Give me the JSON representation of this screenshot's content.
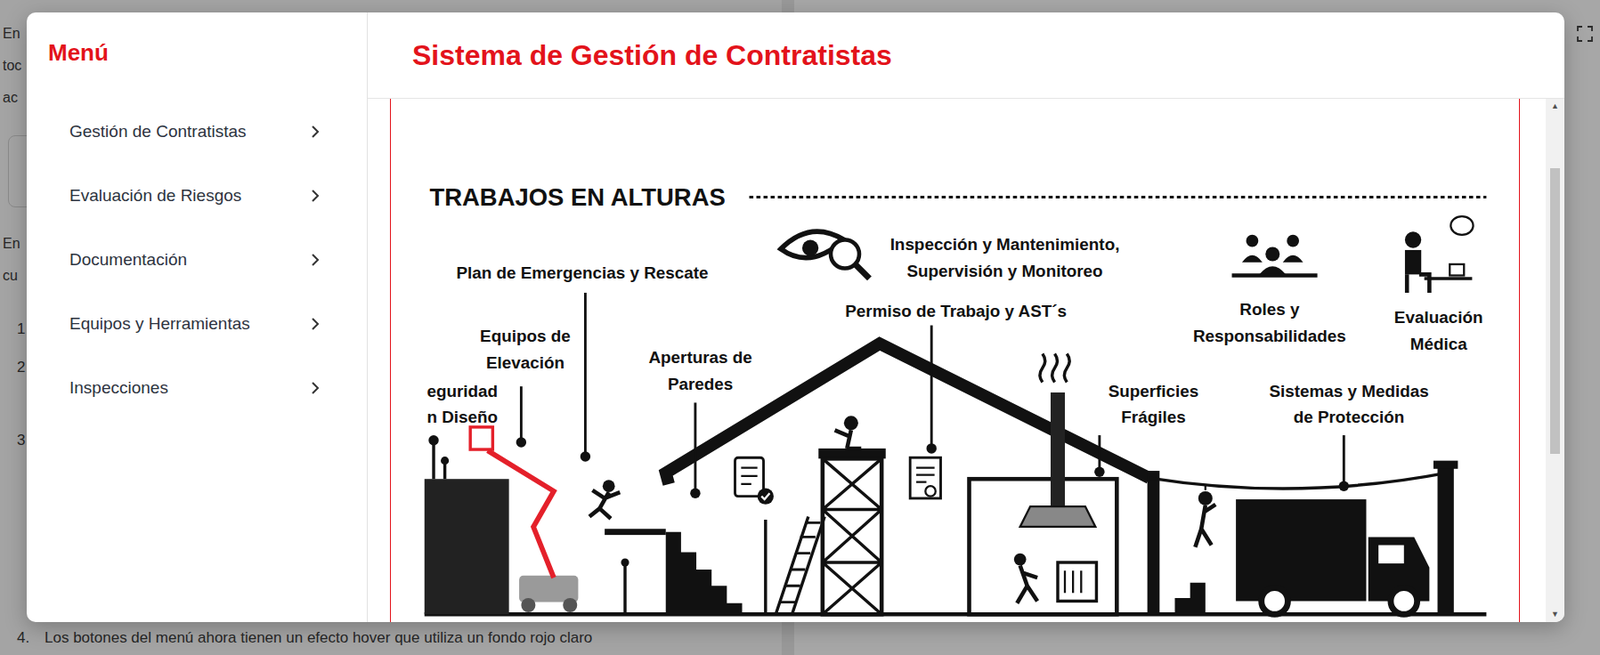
{
  "page": {
    "paragraphs": [
      [
        "En",
        "toc",
        "ac"
      ],
      [
        "En",
        "cu"
      ]
    ],
    "list": [
      {
        "number": "1"
      },
      {
        "number": "2"
      },
      {
        "number": "3"
      },
      {
        "number": "4.",
        "text": "Los botones del menú ahora tienen un efecto hover que utiliza un fondo rojo claro"
      }
    ]
  },
  "modal": {
    "title": "Sistema de Gestión de Contratistas",
    "menu": {
      "heading": "Menú",
      "items": [
        {
          "label": "Gestión de Contratistas",
          "expanded": false
        },
        {
          "label": "Evaluación de Riesgos",
          "expanded": false
        },
        {
          "label": "Documentación",
          "expanded": false
        },
        {
          "label": "Equipos y Herramientas",
          "expanded": false
        },
        {
          "label": "Inspecciones",
          "expanded": false
        }
      ]
    },
    "infographic": {
      "title": "TRABAJOS EN ALTURAS",
      "labels": [
        {
          "lines": [
            "Plan de Emergencias y Rescate"
          ]
        },
        {
          "lines": [
            "Inspección y Mantenimiento,",
            "Supervisión y Monitoreo"
          ]
        },
        {
          "lines": [
            "Roles y",
            "Responsabilidades"
          ]
        },
        {
          "lines": [
            "Evaluación",
            "Médica"
          ]
        },
        {
          "lines": [
            "Permiso de Trabajo y AST´s"
          ]
        },
        {
          "lines": [
            "Equipos de",
            "Elevación"
          ]
        },
        {
          "lines": [
            "Aperturas de",
            "Paredes"
          ]
        },
        {
          "lines": [
            "eguridad",
            "n Diseño"
          ]
        },
        {
          "lines": [
            "Superficies",
            "Frágiles"
          ]
        },
        {
          "lines": [
            "Sistemas y Medidas",
            "de Protección"
          ]
        }
      ]
    },
    "scrollbar": {
      "up": "▲",
      "down": "▼",
      "offset": 0.11,
      "level": 0.58
    }
  }
}
